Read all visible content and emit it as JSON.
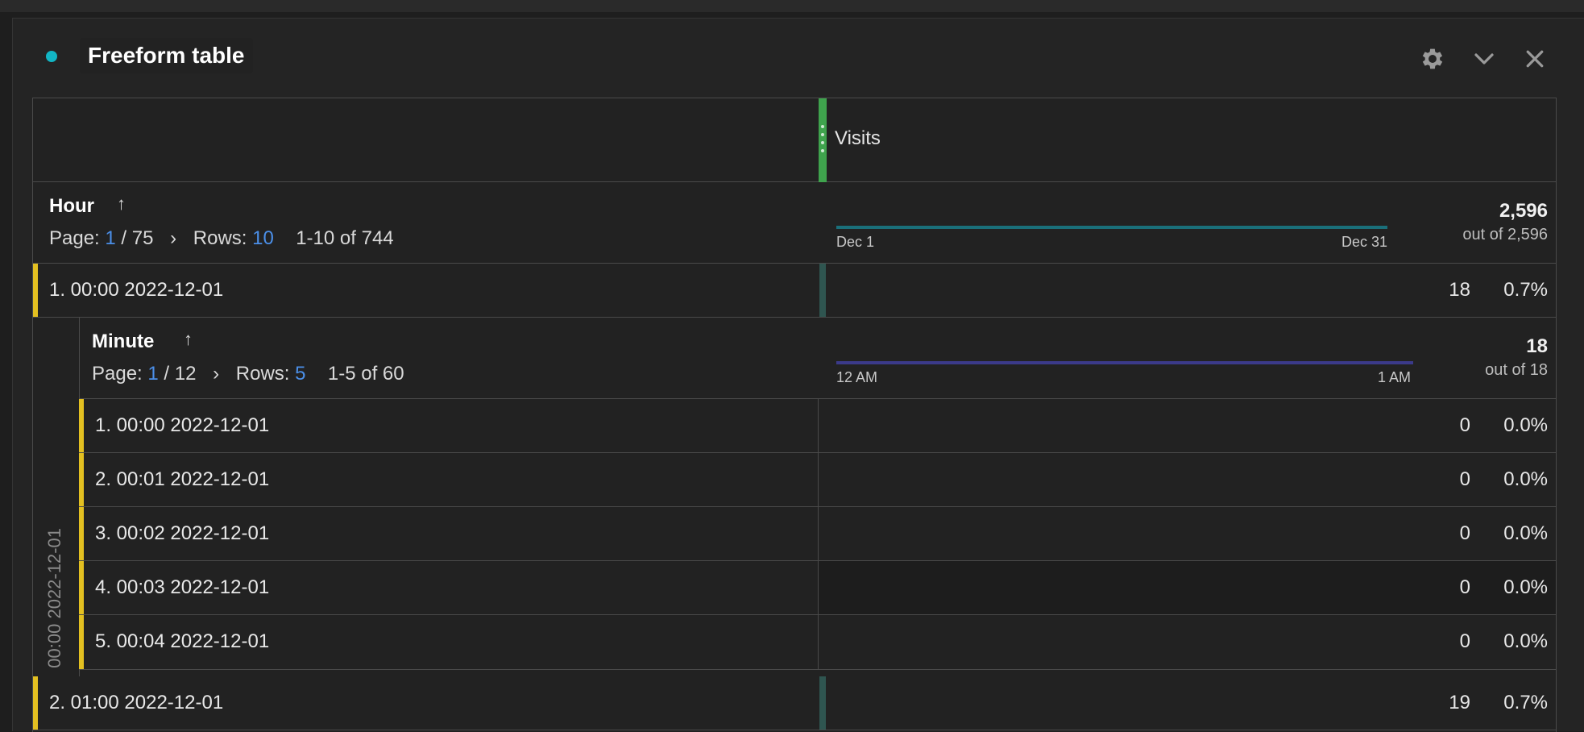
{
  "panel": {
    "title": "Freeform table",
    "status_color": "#12b5c4",
    "icons": [
      "gear-icon",
      "chevron-down-icon",
      "close-icon"
    ]
  },
  "metric": {
    "label": "Visits",
    "color": "#3fa34d"
  },
  "hour_dimension": {
    "name": "Hour",
    "page_label": "Page:",
    "page_current": "1",
    "page_total": "/ 75",
    "rows_label": "Rows:",
    "rows_value": "10",
    "range": "1-10 of 744",
    "spark_start": "Dec 1",
    "spark_end": "Dec 31",
    "spark_color": "#1a6f7a",
    "total": "2,596",
    "out_of": "out of 2,596"
  },
  "hour_rows": [
    {
      "label": "1.  00:00 2022-12-01",
      "value": "18",
      "percent": "0.7%"
    },
    {
      "label": "2.  01:00 2022-12-01",
      "value": "19",
      "percent": "0.7%"
    }
  ],
  "minute_breakdown": {
    "gutter_label": "00:00 2022-12-01",
    "name": "Minute",
    "page_label": "Page:",
    "page_current": "1",
    "page_total": "/ 12",
    "rows_label": "Rows:",
    "rows_value": "5",
    "range": "1-5 of 60",
    "spark_start": "12 AM",
    "spark_end": "1 AM",
    "spark_color": "#3b3a8a",
    "total": "18",
    "out_of": "out of 18",
    "rows": [
      {
        "label": "1.  00:00 2022-12-01",
        "value": "0",
        "percent": "0.0%"
      },
      {
        "label": "2.  00:01 2022-12-01",
        "value": "0",
        "percent": "0.0%"
      },
      {
        "label": "3.  00:02 2022-12-01",
        "value": "0",
        "percent": "0.0%"
      },
      {
        "label": "4.  00:03 2022-12-01",
        "value": "0",
        "percent": "0.0%"
      },
      {
        "label": "5.  00:04 2022-12-01",
        "value": "0",
        "percent": "0.0%"
      }
    ]
  },
  "colors": {
    "row_marker": "#e3c021",
    "link_blue": "#4b8fe8"
  }
}
